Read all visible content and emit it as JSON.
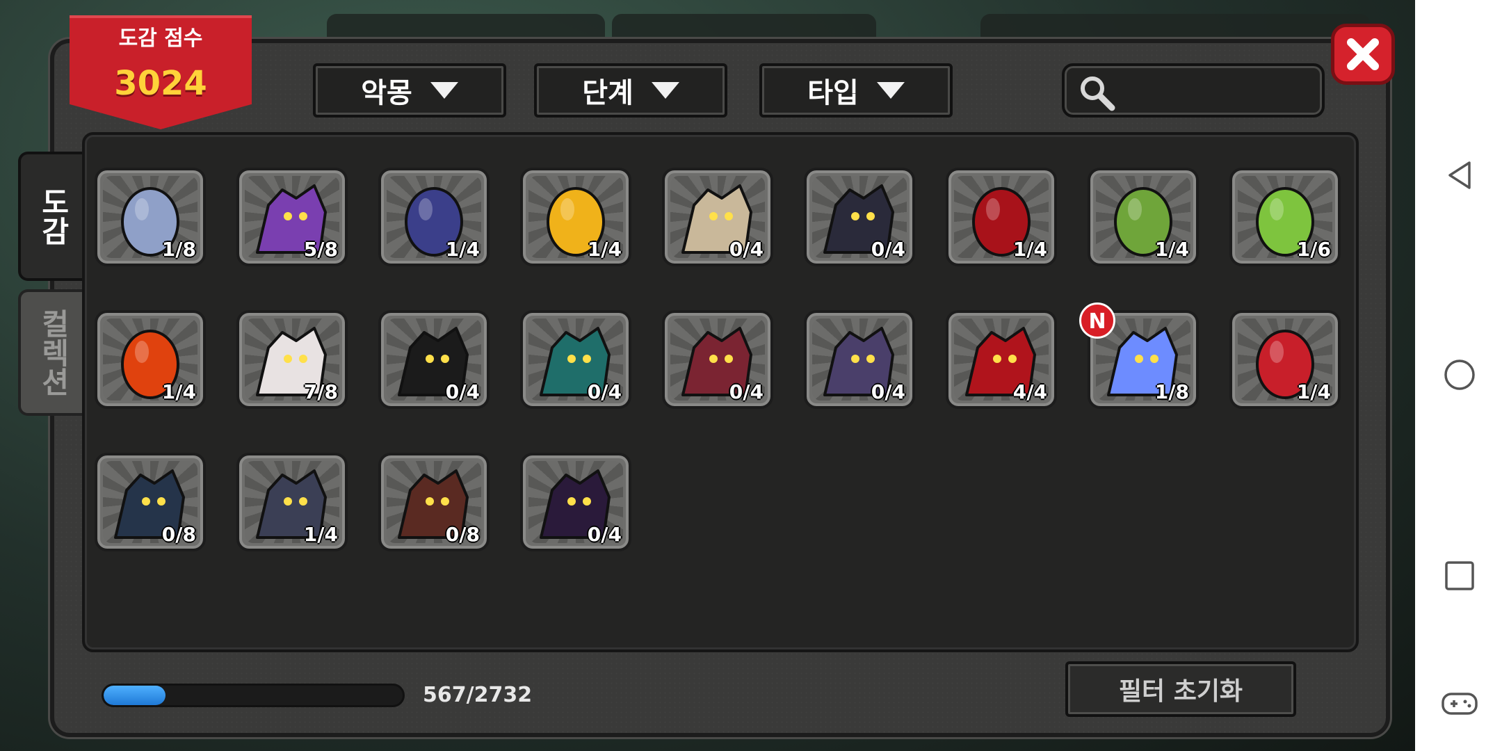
{
  "score": {
    "label": "도감 점수",
    "value": "3024"
  },
  "filters": [
    {
      "label": "악몽"
    },
    {
      "label": "단계"
    },
    {
      "label": "타입"
    }
  ],
  "search": {
    "icon": "search-icon"
  },
  "tabs": [
    {
      "label": "도감",
      "active": true
    },
    {
      "label": "컬렉션",
      "active": false
    }
  ],
  "cards": [
    {
      "count": "1/8",
      "icon": "silver-crown-egg-icon",
      "color": "#8fa0c8"
    },
    {
      "count": "5/8",
      "icon": "purple-dragon-icon",
      "color": "#7a3fb0"
    },
    {
      "count": "1/4",
      "icon": "horned-bow-egg-icon",
      "color": "#3b3f8a"
    },
    {
      "count": "1/4",
      "icon": "golden-keyhole-egg-icon",
      "color": "#f0b21a"
    },
    {
      "count": "0/4",
      "icon": "masked-creature-icon",
      "color": "#c9b89a"
    },
    {
      "count": "0/4",
      "icon": "dark-knight-icon",
      "color": "#2a2a3a"
    },
    {
      "count": "1/4",
      "icon": "red-spiked-egg-icon",
      "color": "#a8121a"
    },
    {
      "count": "1/4",
      "icon": "cactus-egg-icon",
      "color": "#6fa53a"
    },
    {
      "count": "1/6",
      "icon": "green-slime-egg-icon",
      "color": "#7ec43e"
    },
    {
      "count": "1/4",
      "icon": "lava-striped-egg-icon",
      "color": "#e0420e"
    },
    {
      "count": "7/8",
      "icon": "white-red-dragon-icon",
      "color": "#e8e2e2"
    },
    {
      "count": "0/4",
      "icon": "black-wolf-icon",
      "color": "#1b1b1b"
    },
    {
      "count": "0/4",
      "icon": "teal-dragon-icon",
      "color": "#1f6e6a"
    },
    {
      "count": "0/4",
      "icon": "jester-icon",
      "color": "#7b2432"
    },
    {
      "count": "0/4",
      "icon": "hooded-shadow-icon",
      "color": "#4a3f6a"
    },
    {
      "count": "4/4",
      "icon": "crimson-demon-icon",
      "color": "#b0141c"
    },
    {
      "count": "1/8",
      "icon": "spectral-ghost-icon",
      "color": "#6d8cff",
      "badge": "N"
    },
    {
      "count": "1/4",
      "icon": "dark-gem-egg-icon",
      "color": "#c81f2a"
    },
    {
      "count": "0/8",
      "icon": "armored-beast-icon",
      "color": "#25344a"
    },
    {
      "count": "1/4",
      "icon": "spider-crest-icon",
      "color": "#3b3f55"
    },
    {
      "count": "0/8",
      "icon": "fanged-dragon-icon",
      "color": "#5a2a22"
    },
    {
      "count": "0/4",
      "icon": "shadow-dragon-icon",
      "color": "#2a1a3a"
    }
  ],
  "progress": {
    "current": 567,
    "total": 2732,
    "text": "567/2732"
  },
  "reset_button": {
    "label": "필터 초기화"
  },
  "colors": {
    "banner": "#c9202a",
    "score": "#ffd23a",
    "progress": "#2f8fe8",
    "close": "#d5222c"
  }
}
